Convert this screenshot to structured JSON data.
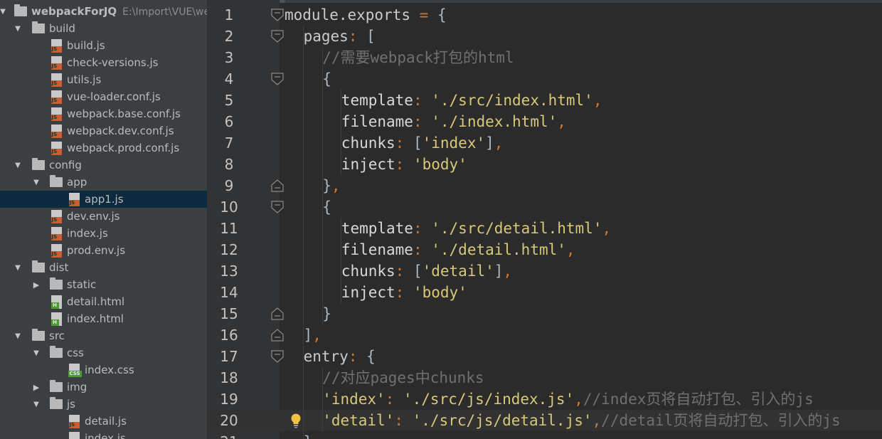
{
  "project": {
    "root_name": "webpackForJQ",
    "root_path": "E:\\Import\\VUE\\webpackForJQ"
  },
  "tree": [
    {
      "label": "build",
      "type": "folder",
      "depth": 1,
      "expanded": true
    },
    {
      "label": "build.js",
      "type": "js",
      "depth": 2
    },
    {
      "label": "check-versions.js",
      "type": "js",
      "depth": 2
    },
    {
      "label": "utils.js",
      "type": "js",
      "depth": 2
    },
    {
      "label": "vue-loader.conf.js",
      "type": "js",
      "depth": 2
    },
    {
      "label": "webpack.base.conf.js",
      "type": "js",
      "depth": 2
    },
    {
      "label": "webpack.dev.conf.js",
      "type": "js",
      "depth": 2
    },
    {
      "label": "webpack.prod.conf.js",
      "type": "js",
      "depth": 2
    },
    {
      "label": "config",
      "type": "folder",
      "depth": 1,
      "expanded": true
    },
    {
      "label": "app",
      "type": "folder",
      "depth": 2,
      "expanded": true
    },
    {
      "label": "app1.js",
      "type": "js",
      "depth": 3,
      "selected": true
    },
    {
      "label": "dev.env.js",
      "type": "js",
      "depth": 2
    },
    {
      "label": "index.js",
      "type": "js",
      "depth": 2
    },
    {
      "label": "prod.env.js",
      "type": "js",
      "depth": 2
    },
    {
      "label": "dist",
      "type": "folder",
      "depth": 1,
      "expanded": true
    },
    {
      "label": "static",
      "type": "folder",
      "depth": 2,
      "expanded": false
    },
    {
      "label": "detail.html",
      "type": "html",
      "depth": 2
    },
    {
      "label": "index.html",
      "type": "html",
      "depth": 2
    },
    {
      "label": "src",
      "type": "folder",
      "depth": 1,
      "expanded": true
    },
    {
      "label": "css",
      "type": "folder",
      "depth": 2,
      "expanded": true
    },
    {
      "label": "index.css",
      "type": "css",
      "depth": 3
    },
    {
      "label": "img",
      "type": "folder",
      "depth": 2,
      "expanded": false
    },
    {
      "label": "js",
      "type": "folder",
      "depth": 2,
      "expanded": true
    },
    {
      "label": "detail.js",
      "type": "js",
      "depth": 3
    },
    {
      "label": "index.js",
      "type": "js",
      "depth": 3
    }
  ],
  "file_tags": {
    "js": "JS",
    "html": "H",
    "css": "CSS"
  },
  "editor": {
    "current_line": 20,
    "lines": [
      {
        "n": "1",
        "indent": 0,
        "fold": "open",
        "tokens": [
          [
            "key",
            "module.exports "
          ],
          [
            "punc",
            "= "
          ],
          [
            "plain",
            "{"
          ]
        ]
      },
      {
        "n": "2",
        "indent": 1,
        "fold": "open",
        "tokens": [
          [
            "key",
            "pages"
          ],
          [
            "punc",
            ": "
          ],
          [
            "plain",
            "["
          ]
        ]
      },
      {
        "n": "3",
        "indent": 2,
        "fold": null,
        "tokens": [
          [
            "com",
            "//需要webpack打包的html"
          ]
        ]
      },
      {
        "n": "4",
        "indent": 2,
        "fold": "open",
        "tokens": [
          [
            "plain",
            "{"
          ]
        ]
      },
      {
        "n": "5",
        "indent": 3,
        "fold": null,
        "tokens": [
          [
            "prop",
            "template"
          ],
          [
            "punc",
            ": "
          ],
          [
            "str",
            "'./src/index.html'"
          ],
          [
            "punc",
            ","
          ]
        ]
      },
      {
        "n": "6",
        "indent": 3,
        "fold": null,
        "tokens": [
          [
            "prop",
            "filename"
          ],
          [
            "punc",
            ": "
          ],
          [
            "str",
            "'./index.html'"
          ],
          [
            "punc",
            ","
          ]
        ]
      },
      {
        "n": "7",
        "indent": 3,
        "fold": null,
        "tokens": [
          [
            "prop",
            "chunks"
          ],
          [
            "punc",
            ": "
          ],
          [
            "plain",
            "["
          ],
          [
            "str",
            "'index'"
          ],
          [
            "plain",
            "]"
          ],
          [
            "punc",
            ","
          ]
        ]
      },
      {
        "n": "8",
        "indent": 3,
        "fold": null,
        "tokens": [
          [
            "prop",
            "inject"
          ],
          [
            "punc",
            ": "
          ],
          [
            "str",
            "'body'"
          ]
        ]
      },
      {
        "n": "9",
        "indent": 2,
        "fold": "close",
        "tokens": [
          [
            "plain",
            "}"
          ],
          [
            "punc",
            ","
          ]
        ]
      },
      {
        "n": "10",
        "indent": 2,
        "fold": "open",
        "tokens": [
          [
            "plain",
            "{"
          ]
        ]
      },
      {
        "n": "11",
        "indent": 3,
        "fold": null,
        "tokens": [
          [
            "prop",
            "template"
          ],
          [
            "punc",
            ": "
          ],
          [
            "str",
            "'./src/detail.html'"
          ],
          [
            "punc",
            ","
          ]
        ]
      },
      {
        "n": "12",
        "indent": 3,
        "fold": null,
        "tokens": [
          [
            "prop",
            "filename"
          ],
          [
            "punc",
            ": "
          ],
          [
            "str",
            "'./detail.html'"
          ],
          [
            "punc",
            ","
          ]
        ]
      },
      {
        "n": "13",
        "indent": 3,
        "fold": null,
        "tokens": [
          [
            "prop",
            "chunks"
          ],
          [
            "punc",
            ": "
          ],
          [
            "plain",
            "["
          ],
          [
            "str",
            "'detail'"
          ],
          [
            "plain",
            "]"
          ],
          [
            "punc",
            ","
          ]
        ]
      },
      {
        "n": "14",
        "indent": 3,
        "fold": null,
        "tokens": [
          [
            "prop",
            "inject"
          ],
          [
            "punc",
            ": "
          ],
          [
            "str",
            "'body'"
          ]
        ]
      },
      {
        "n": "15",
        "indent": 2,
        "fold": "close",
        "tokens": [
          [
            "plain",
            "}"
          ]
        ]
      },
      {
        "n": "16",
        "indent": 1,
        "fold": "close",
        "tokens": [
          [
            "plain",
            "]"
          ],
          [
            "punc",
            ","
          ]
        ]
      },
      {
        "n": "17",
        "indent": 1,
        "fold": "open",
        "tokens": [
          [
            "key",
            "entry"
          ],
          [
            "punc",
            ": "
          ],
          [
            "plain",
            "{"
          ]
        ]
      },
      {
        "n": "18",
        "indent": 2,
        "fold": null,
        "tokens": [
          [
            "com",
            "//对应pages中chunks"
          ]
        ]
      },
      {
        "n": "19",
        "indent": 2,
        "fold": null,
        "tokens": [
          [
            "str",
            "'index'"
          ],
          [
            "punc",
            ": "
          ],
          [
            "str",
            "'./src/js/index.js'"
          ],
          [
            "punc",
            ","
          ],
          [
            "com",
            "//index页将自动打包、引入的js"
          ]
        ]
      },
      {
        "n": "20",
        "indent": 2,
        "fold": null,
        "bulb": true,
        "tokens": [
          [
            "str",
            "'detail'"
          ],
          [
            "punc",
            ": "
          ],
          [
            "str",
            "'./src/js/detail.js'"
          ],
          [
            "punc",
            ","
          ],
          [
            "com",
            "//detail页将自动打包、引入的js"
          ]
        ]
      },
      {
        "n": "21",
        "indent": 1,
        "fold": null,
        "tokens": [
          [
            "plain",
            "}"
          ]
        ]
      }
    ]
  },
  "colors": {
    "tree_bg": "#3c3f41",
    "selection": "#0d293e",
    "editor_bg": "#2b2b2b",
    "gutter_bg": "#313335",
    "string": "#d7c87a",
    "comment": "#6f7072",
    "punctuation": "#cc7832"
  }
}
